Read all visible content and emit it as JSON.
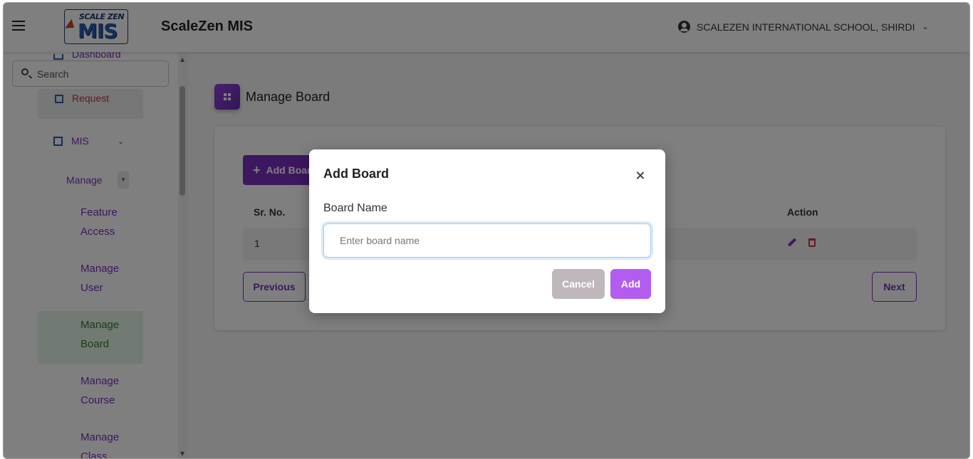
{
  "header": {
    "app_title": "ScaleZen MIS",
    "logo_top": "SCALE ZEN",
    "logo_main": "MIS",
    "school_name": "SCALEZEN INTERNATIONAL SCHOOL, SHIRDI",
    "menu_icon": "hamburger-icon",
    "user_icon": "account-circle-icon",
    "dropdown_icon": "chevron-down-icon"
  },
  "sidebar": {
    "dashboard_label": "Dashboard",
    "search_placeholder": "Search",
    "request_label": "Request",
    "mis_label": "MIS",
    "manage_label": "Manage",
    "items": [
      {
        "line1": "Feature",
        "line2": "Access"
      },
      {
        "line1": "Manage",
        "line2": "User"
      },
      {
        "line1": "Manage",
        "line2": "Board",
        "active": true
      },
      {
        "line1": "Manage",
        "line2": "Course"
      },
      {
        "line1": "Manage",
        "line2": "Class"
      }
    ]
  },
  "main": {
    "page_title": "Manage Board",
    "add_button": "Add Board",
    "columns": [
      "Sr. No.",
      "Action"
    ],
    "rows": [
      {
        "sr_no": "1"
      }
    ],
    "previous_label": "Previous",
    "next_label": "Next"
  },
  "modal": {
    "title": "Add Board",
    "field_label": "Board Name",
    "field_placeholder": "Enter board name",
    "field_value": "",
    "cancel_label": "Cancel",
    "add_label": "Add"
  },
  "colors": {
    "primary": "#7b2fbf",
    "add_button": "#b35df0",
    "cancel_button": "#c0b7bd",
    "active_item_bg": "#e2f4e6",
    "active_item_text": "#2e7d32",
    "overlay": "rgba(0,0,0,0.5)"
  }
}
